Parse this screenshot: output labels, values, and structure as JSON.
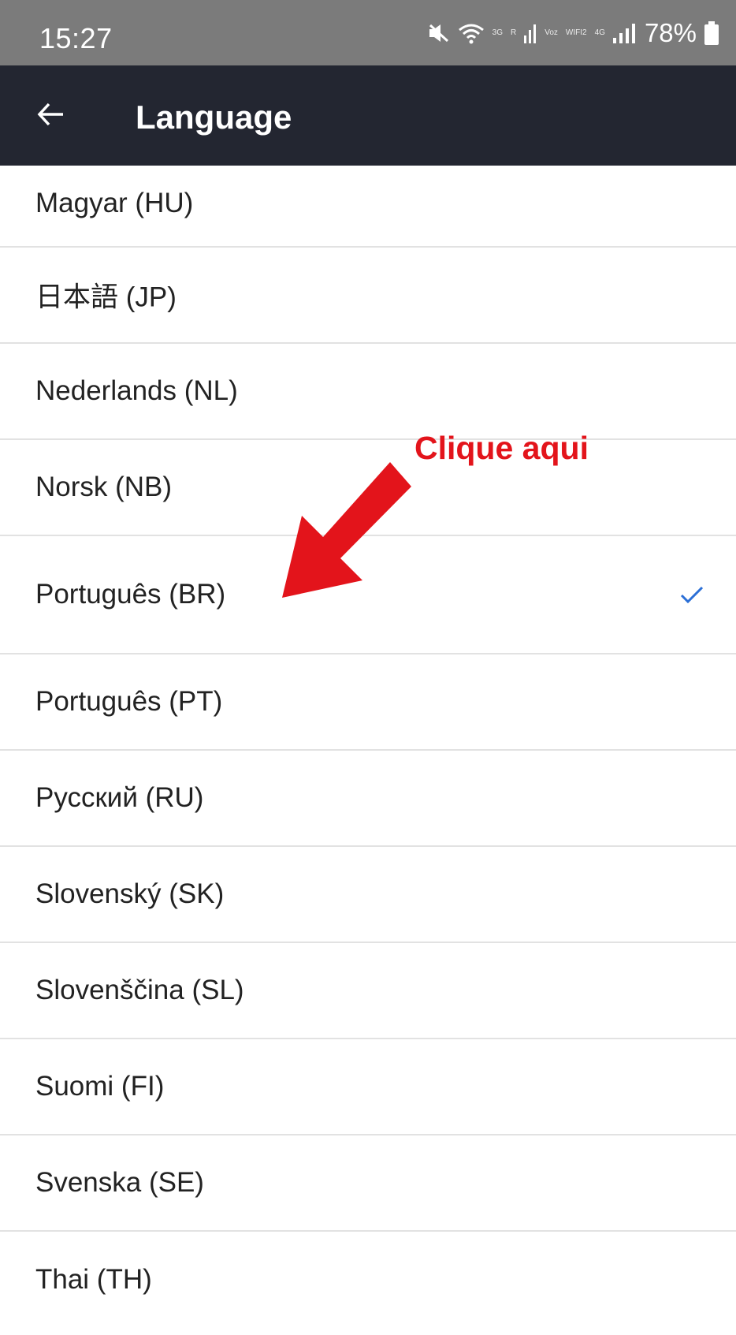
{
  "status_bar": {
    "time": "15:27",
    "network_3g": "3G",
    "roaming": "R",
    "voz": "Voz",
    "wifi2": "WIFI2",
    "network_4g": "4G",
    "battery": "78%",
    "icons": [
      "mute-icon",
      "wifi-icon",
      "signal-icon",
      "battery-icon"
    ]
  },
  "app_bar": {
    "title": "Language",
    "back_icon": "arrow-left-icon",
    "background": "#232631"
  },
  "languages": [
    {
      "label": "Magyar (HU)"
    },
    {
      "label": "日本語 (JP)"
    },
    {
      "label": "Nederlands (NL)"
    },
    {
      "label": "Norsk (NB)"
    },
    {
      "label": "Português (BR)",
      "selected": true
    },
    {
      "label": "Português (PT)"
    },
    {
      "label": "Русский (RU)"
    },
    {
      "label": "Slovenský (SK)"
    },
    {
      "label": "Slovenščina (SL)"
    },
    {
      "label": "Suomi (FI)"
    },
    {
      "label": "Svenska (SE)"
    },
    {
      "label": "Thai (TH)"
    }
  ],
  "selected_check_color": "#2b6fd6",
  "annotation": {
    "text": "Clique aqui",
    "color": "#e3141b"
  }
}
